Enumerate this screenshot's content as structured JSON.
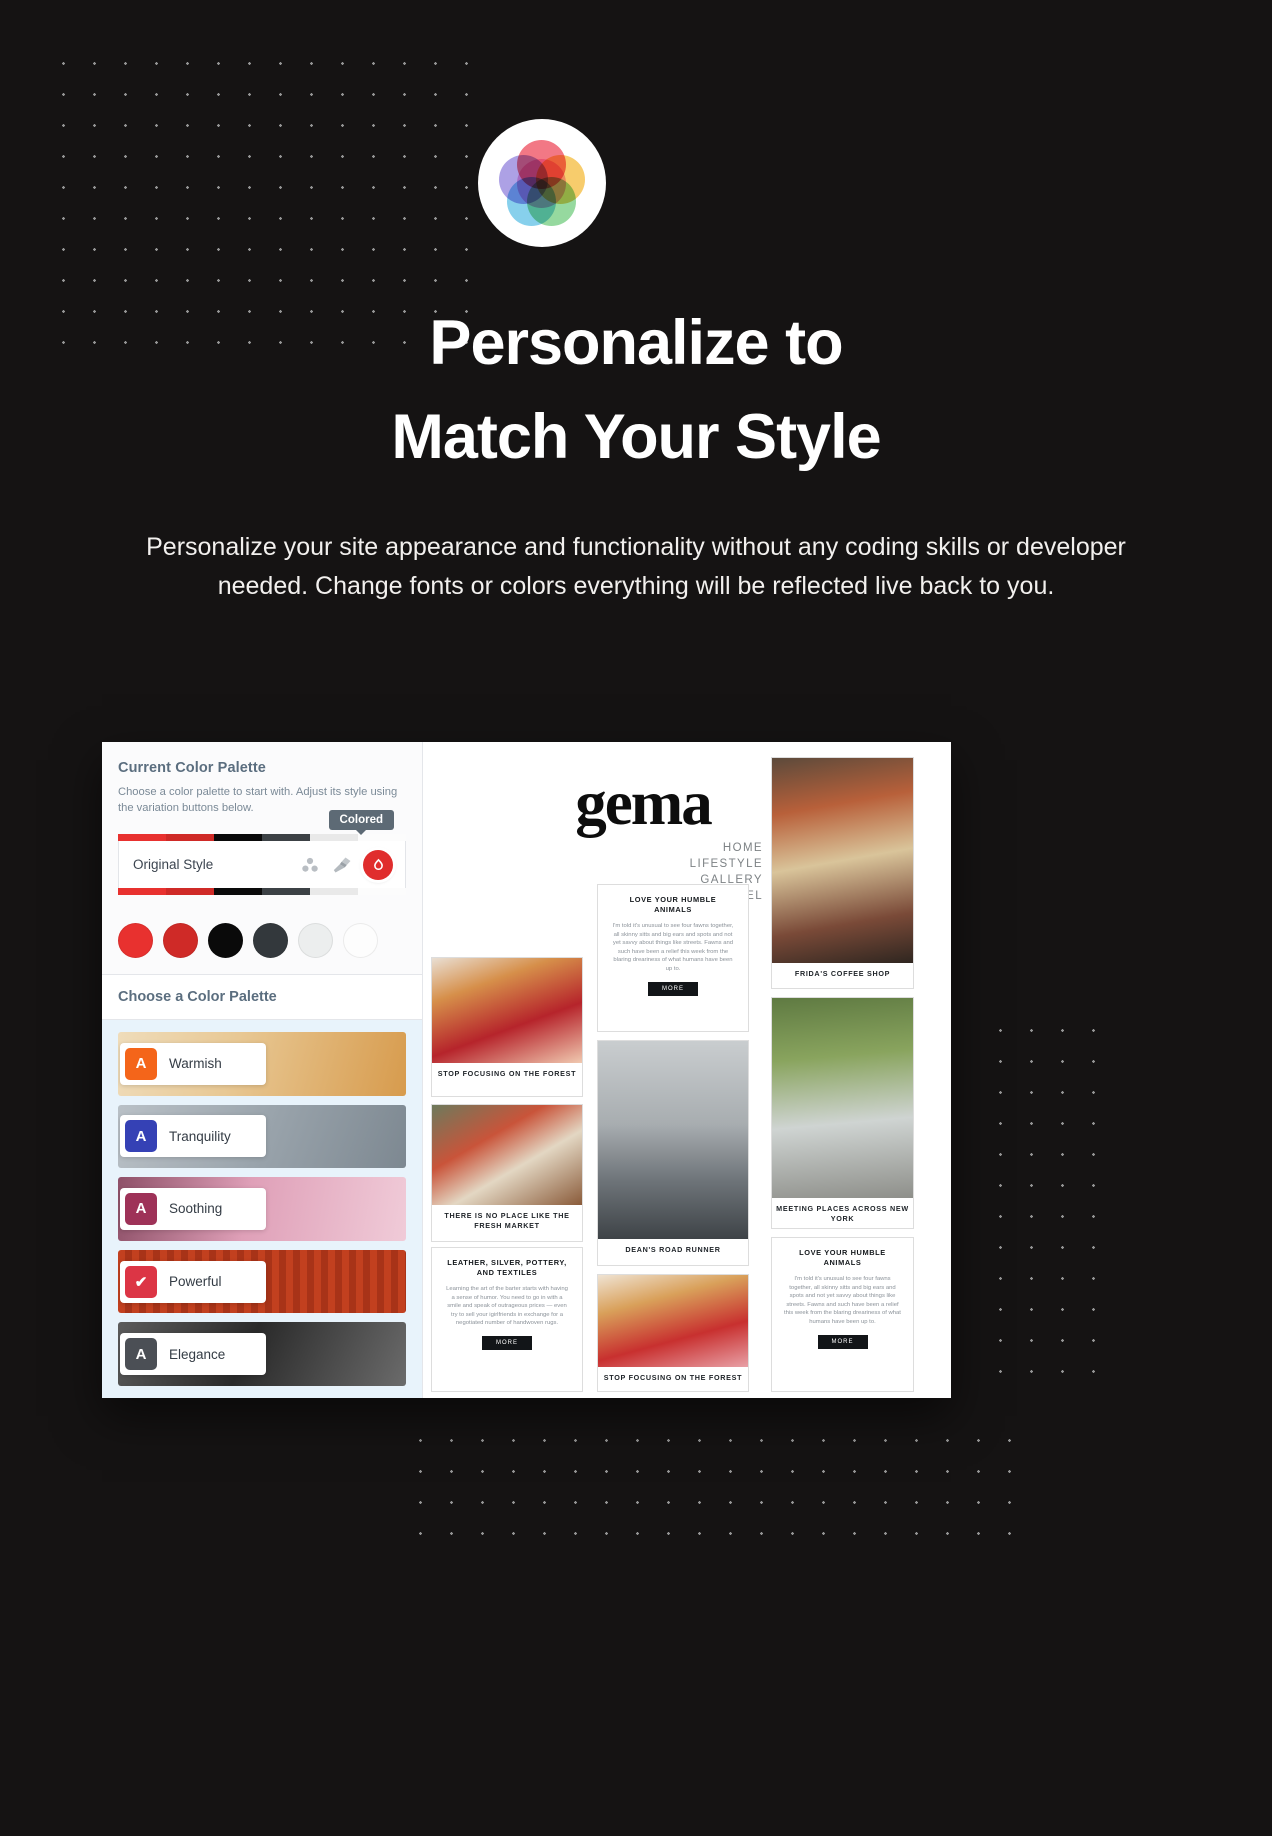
{
  "hero": {
    "logo_name": "color-wheel-logo",
    "title_line1": "Personalize to",
    "title_line2": "Match Your Style",
    "description": "Personalize your site appearance and functionality without any coding skills or developer needed. Change fonts or colors everything will be reflected live back to you."
  },
  "colors": {
    "background": "#151313",
    "text": "#ffffff",
    "accent_red": "#e02d2d",
    "sidebar_heading": "#5b6e7f",
    "palette_list_bg": "#e8f3fb"
  },
  "customizer": {
    "current_palette": {
      "heading": "Current Color Palette",
      "description": "Choose a color palette to start with. Adjust its style using the variation buttons below.",
      "style_name": "Original Style",
      "tooltip": "Colored",
      "icons": [
        {
          "name": "palette-dots-icon"
        },
        {
          "name": "paint-brush-icon"
        },
        {
          "name": "color-drop-icon"
        }
      ],
      "stripe_colors": [
        "#e8312f",
        "#cf2a27",
        "#0a0a0a",
        "#3c4145",
        "#e9e9e9",
        "#fcfcfc"
      ],
      "swatches": [
        "#e8312f",
        "#cf2a27",
        "#0a0a0a",
        "#33383c",
        "#eceeee",
        "#fdfdfd"
      ]
    },
    "choose_palette": {
      "heading": "Choose a Color Palette",
      "items": [
        {
          "label": "Warmish",
          "badge": "A",
          "badge_color": "#f4651a",
          "selected": false,
          "bg_from": "#e8cfa4",
          "bg_to": "#d9a460"
        },
        {
          "label": "Tranquility",
          "badge": "A",
          "badge_color": "#3541b5",
          "selected": false,
          "bg_from": "#a8b0b8",
          "bg_to": "#8e979f"
        },
        {
          "label": "Soothing",
          "badge": "A",
          "badge_color": "#9e3258",
          "selected": false,
          "bg_from": "#e3a3bb",
          "bg_to": "#b86f8c"
        },
        {
          "label": "Powerful",
          "badge": "✔",
          "badge_color": "#dc3545",
          "selected": true,
          "bg_from": "#bf3a22",
          "bg_to": "#8e2a17"
        },
        {
          "label": "Elegance",
          "badge": "A",
          "badge_color": "#4b4f55",
          "selected": false,
          "bg_from": "#4a4a4a",
          "bg_to": "#1e1e1e"
        }
      ]
    }
  },
  "preview": {
    "brand": "gema",
    "nav": [
      "HOME",
      "LIFESTYLE",
      "GALLERY",
      "TRAVEL"
    ],
    "cards": [
      {
        "id": "flowers-shop",
        "caption": "STOP FOCUSING ON THE FOREST"
      },
      {
        "id": "fresh-market",
        "caption": "THERE IS NO PLACE LIKE THE FRESH MARKET"
      },
      {
        "id": "coffee-shop",
        "caption": "FRIDA'S COFFEE SHOP"
      },
      {
        "id": "bikes-ny",
        "caption": "MEETING PLACES ACROSS NEW YORK"
      },
      {
        "id": "deans-road",
        "caption": "DEAN'S ROAD RUNNER"
      },
      {
        "id": "flowers-2",
        "caption": "STOP FOCUSING ON THE FOREST"
      }
    ],
    "articles": [
      {
        "id": "humble-animals-top",
        "title": "LOVE YOUR HUMBLE ANIMALS",
        "body": "I'm told it's unusual to see four fawns together, all skinny sitts and big ears and spots and not yet savvy about things like streets. Fawns and such have been a relief this week from the blaring dreariness of what humans have been up to.",
        "button": "MORE"
      },
      {
        "id": "leather-silver",
        "title": "LEATHER, SILVER, POTTERY, AND TEXTILES",
        "body": "Learning the art of the barter starts with having a sense of humor. You need to go in with a smile and speak of outrageous prices — even try to sell your igirlfriends in exchange for a negotiated number of handwoven rugs.",
        "button": "MORE"
      },
      {
        "id": "humble-animals-bottom",
        "title": "LOVE YOUR HUMBLE ANIMALS",
        "body": "I'm told it's unusual to see four fawns together, all skinny sitts and big ears and spots and not yet savvy about things like streets. Fawns and such have been a relief this week from the blaring dreariness of what humans have been up to.",
        "button": "MORE"
      }
    ]
  }
}
